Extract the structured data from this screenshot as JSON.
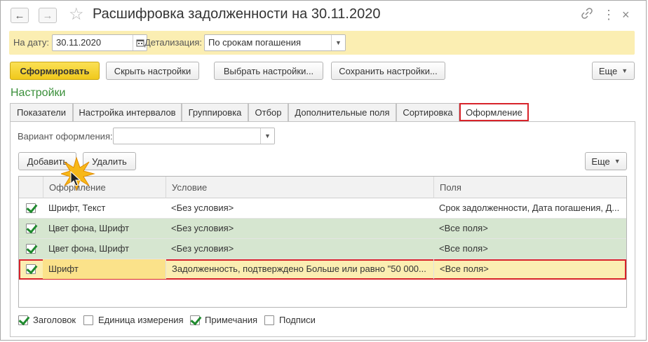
{
  "window": {
    "title": "Расшифровка задолженности на 30.11.2020",
    "nav": {
      "back_icon": "arrow-left-icon",
      "forward_icon": "arrow-right-icon"
    },
    "title_icons": [
      "link-icon",
      "more-icon",
      "close-icon"
    ]
  },
  "filters": {
    "date_label": "На дату:",
    "date_value": "30.11.2020",
    "detail_label": "Детализация:",
    "detail_value": "По срокам погашения"
  },
  "toolbar": {
    "generate": "Сформировать",
    "hide_settings": "Скрыть настройки",
    "choose_settings": "Выбрать настройки...",
    "save_settings": "Сохранить настройки...",
    "more": "Еще"
  },
  "settings": {
    "title": "Настройки",
    "tabs": [
      {
        "label": "Показатели"
      },
      {
        "label": "Настройка интервалов"
      },
      {
        "label": "Группировка"
      },
      {
        "label": "Отбор"
      },
      {
        "label": "Дополнительные поля"
      },
      {
        "label": "Сортировка"
      },
      {
        "label": "Оформление",
        "active": true
      }
    ],
    "variant_label": "Вариант оформления:",
    "variant_value": "",
    "add": "Добавить",
    "delete": "Удалить",
    "more": "Еще"
  },
  "table": {
    "columns": [
      "Оформление",
      "Условие",
      "Поля"
    ],
    "rows": [
      {
        "checked": true,
        "format": "Шрифт, Текст",
        "condition": "<Без условия>",
        "fields": "Срок задолженности, Дата погашения, Д..."
      },
      {
        "checked": true,
        "format": "Цвет фона, Шрифт",
        "condition": "<Без условия>",
        "fields": "<Все поля>"
      },
      {
        "checked": true,
        "format": "Цвет фона, Шрифт",
        "condition": "<Без условия>",
        "fields": "<Все поля>"
      },
      {
        "checked": true,
        "format": "Шрифт",
        "condition": "Задолженность, подтверждено Больше или равно \"50 000...",
        "fields": "<Все поля>"
      }
    ]
  },
  "footer": {
    "checkboxes": [
      {
        "label": "Заголовок",
        "checked": true
      },
      {
        "label": "Единица измерения",
        "checked": false
      },
      {
        "label": "Примечания",
        "checked": true
      },
      {
        "label": "Подписи",
        "checked": false
      }
    ]
  },
  "colors": {
    "accent_green": "#3a8f3a",
    "highlight_red": "#d8232a",
    "yellow_bar": "#fbeeb2",
    "row_green": "#d6e6d0"
  }
}
